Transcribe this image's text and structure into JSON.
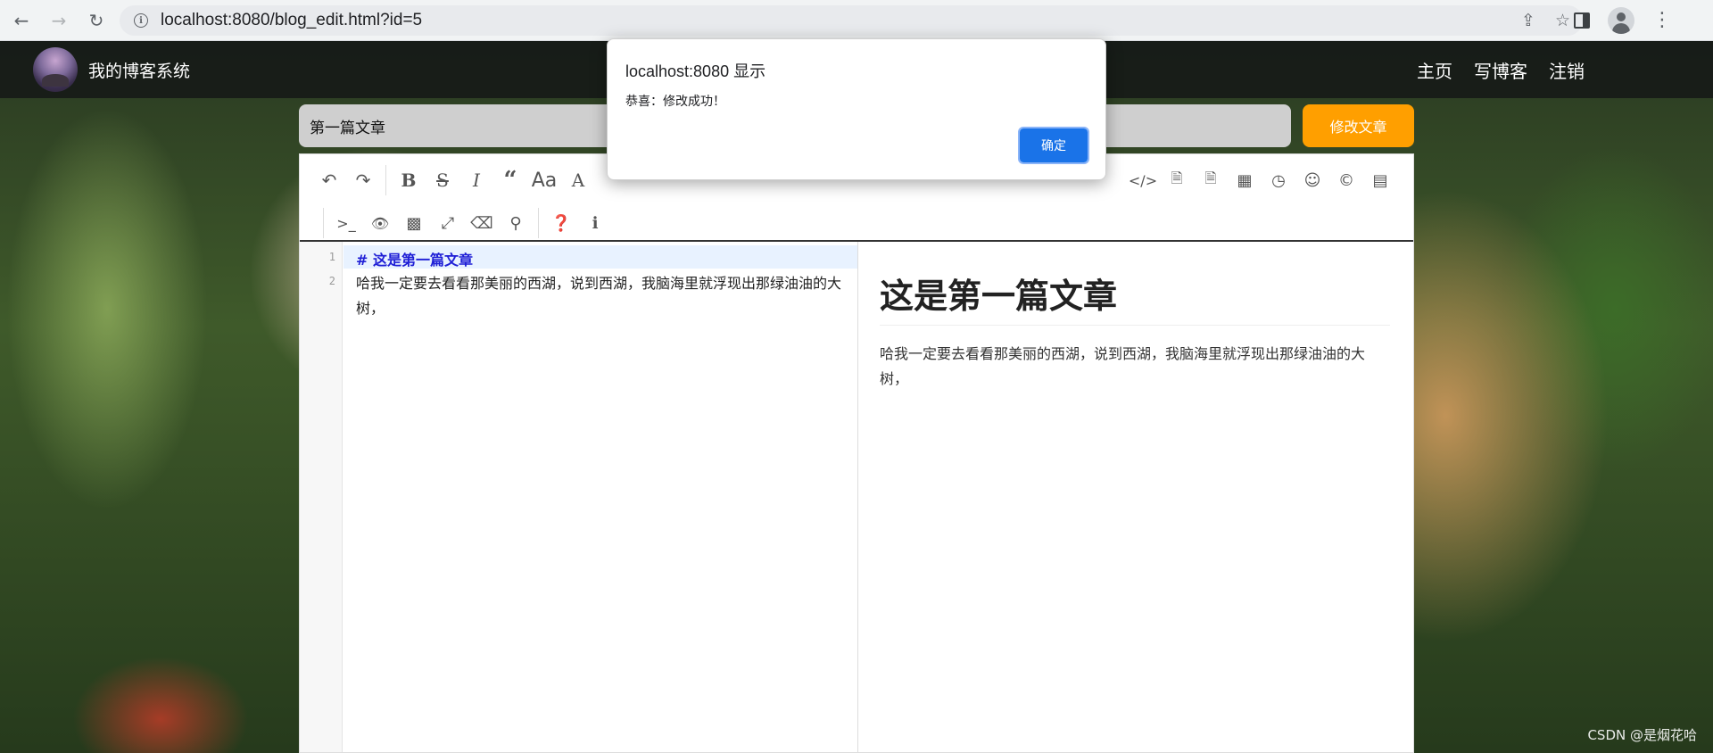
{
  "browser": {
    "url": "localhost:8080/blog_edit.html?id=5"
  },
  "app": {
    "site_title": "我的博客系统",
    "nav": [
      "主页",
      "写博客",
      "注销"
    ]
  },
  "editor": {
    "title_value": "第一篇文章",
    "publish_label": "修改文章",
    "line_numbers": [
      "1",
      "2"
    ],
    "source_heading": "#  这是第一篇文章",
    "source_paragraph": "哈我一定要去看看那美丽的西湖，说到西湖，我脑海里就浮现出那绿油油的大树，",
    "preview_heading": "这是第一篇文章",
    "preview_paragraph": "哈我一定要去看看那美丽的西湖，说到西湖，我脑海里就浮现出那绿油油的大树，",
    "toolbar": {
      "heading_glyph": "Aa",
      "font_glyph": "A"
    }
  },
  "alert": {
    "title": "localhost:8080 显示",
    "message": "恭喜：修改成功！",
    "ok_label": "确定"
  },
  "watermark": "CSDN @是烟花哈"
}
